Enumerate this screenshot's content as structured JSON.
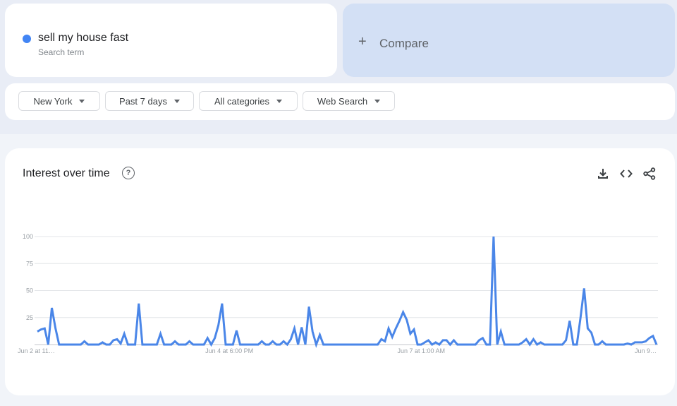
{
  "search_term": {
    "name": "sell my house fast",
    "subtitle": "Search term",
    "color": "#4285f4"
  },
  "compare": {
    "icon": "plus-icon",
    "label": "Compare"
  },
  "filters": [
    {
      "label": "New York",
      "icon": "caret-down-icon"
    },
    {
      "label": "Past 7 days",
      "icon": "caret-down-icon"
    },
    {
      "label": "All categories",
      "icon": "caret-down-icon"
    },
    {
      "label": "Web Search",
      "icon": "caret-down-icon"
    }
  ],
  "panel": {
    "title": "Interest over time",
    "help_icon": "help-circle-icon",
    "help_glyph": "?",
    "actions": [
      "download-icon",
      "embed-code-icon",
      "share-icon"
    ]
  },
  "chart_data": {
    "type": "line",
    "title": "Interest over time",
    "xlabel": "",
    "ylabel": "",
    "ylim": [
      0,
      100
    ],
    "yticks": [
      100,
      75,
      50,
      25
    ],
    "xtick_labels": [
      "Jun 2 at 11…",
      "Jun 4 at 6:00 PM",
      "Jun 7 at 1:00 AM",
      "Jun 9…"
    ],
    "xtick_positions": [
      0,
      53,
      106,
      168
    ],
    "grid": true,
    "series": [
      {
        "name": "sell my house fast",
        "color": "#4a86e8",
        "values": [
          12,
          14,
          15,
          0,
          34,
          15,
          0,
          0,
          0,
          0,
          0,
          0,
          0,
          3,
          0,
          0,
          0,
          0,
          2,
          0,
          0,
          4,
          5,
          1,
          10,
          0,
          0,
          0,
          38,
          0,
          0,
          0,
          0,
          0,
          10,
          0,
          0,
          0,
          3,
          0,
          0,
          0,
          3,
          0,
          0,
          0,
          0,
          6,
          0,
          6,
          18,
          38,
          0,
          0,
          0,
          13,
          0,
          0,
          0,
          0,
          0,
          0,
          3,
          0,
          0,
          3,
          0,
          0,
          3,
          0,
          5,
          15,
          0,
          16,
          0,
          35,
          12,
          0,
          9,
          0,
          0,
          0,
          0,
          0,
          0,
          0,
          0,
          0,
          0,
          0,
          0,
          0,
          0,
          0,
          0,
          5,
          3,
          15,
          7,
          15,
          22,
          30,
          23,
          10,
          14,
          0,
          0,
          2,
          4,
          0,
          2,
          0,
          4,
          4,
          0,
          4,
          0,
          0,
          0,
          0,
          0,
          0,
          4,
          6,
          0,
          0,
          100,
          0,
          12,
          0,
          0,
          0,
          0,
          0,
          2,
          5,
          0,
          5,
          0,
          2,
          0,
          0,
          0,
          0,
          0,
          0,
          4,
          22,
          0,
          0,
          25,
          52,
          15,
          11,
          0,
          0,
          3,
          0,
          0,
          0,
          0,
          0,
          0,
          1,
          0,
          2,
          2,
          2,
          3,
          6,
          8,
          0
        ]
      }
    ]
  }
}
